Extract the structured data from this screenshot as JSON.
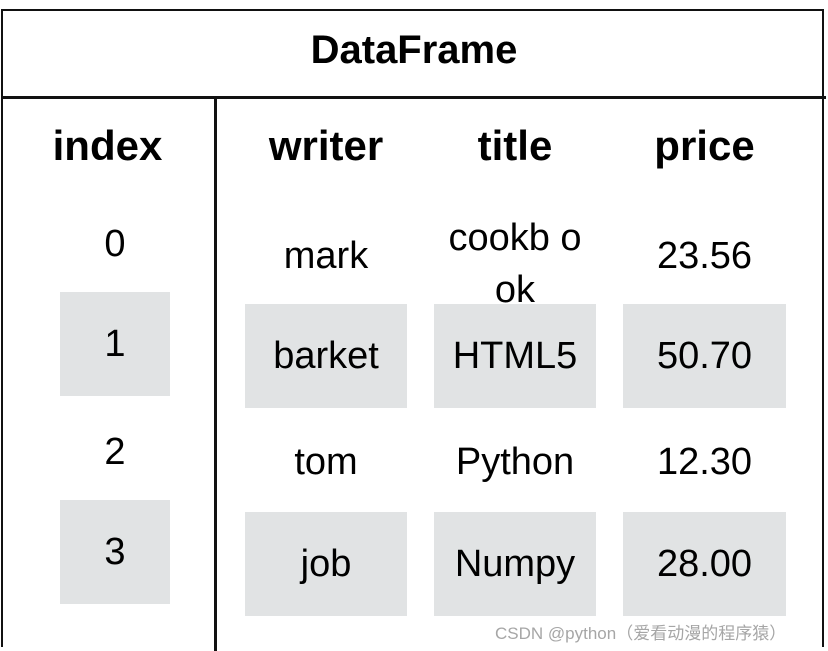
{
  "title": "DataFrame",
  "index_header": "index",
  "columns": [
    "writer",
    "title",
    "price"
  ],
  "index": [
    "0",
    "1",
    "2",
    "3"
  ],
  "rows": [
    [
      "mark",
      "cookb ook",
      "23.56"
    ],
    [
      "barket",
      "HTML5",
      "50.70"
    ],
    [
      "tom",
      "Python",
      "12.30"
    ],
    [
      "job",
      "Numpy",
      "28.00"
    ]
  ],
  "shade_color": "#e1e3e4",
  "watermark": "CSDN @python（爱看动漫的程序猿）"
}
